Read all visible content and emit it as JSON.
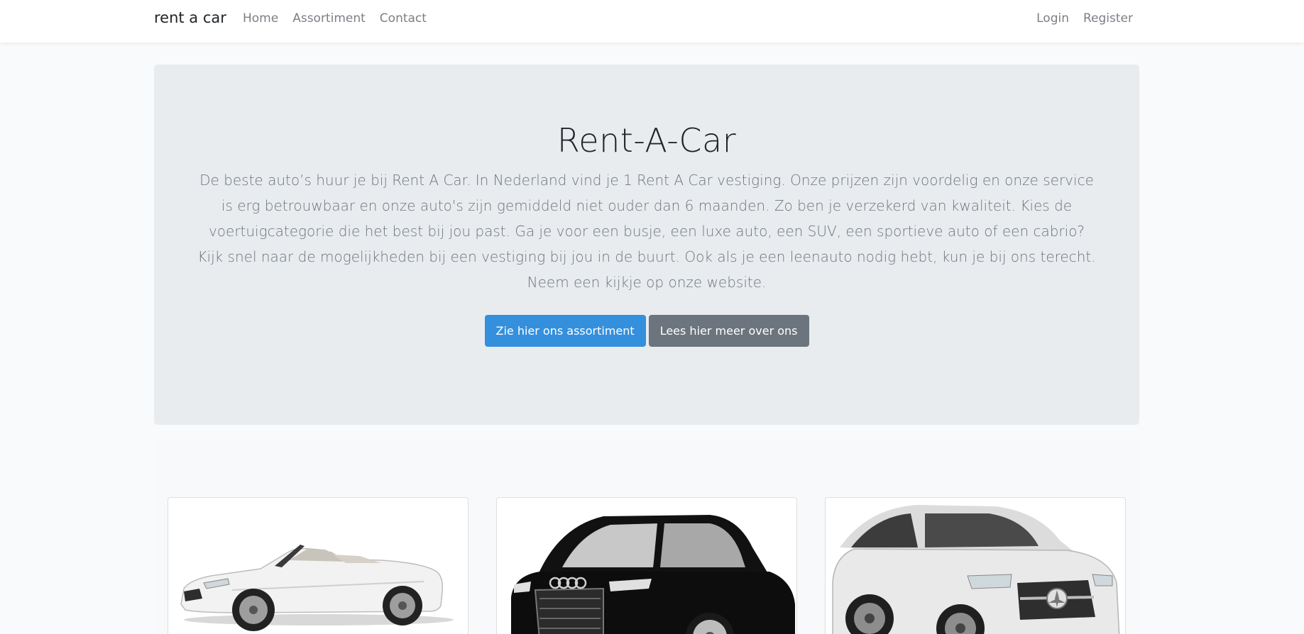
{
  "navbar": {
    "brand": "rent a car",
    "left_links": [
      "Home",
      "Assortiment",
      "Contact"
    ],
    "right_links": [
      "Login",
      "Register"
    ]
  },
  "jumbotron": {
    "title": "Rent-A-Car",
    "text": "De beste auto’s huur je bij Rent A Car. In Nederland vind je 1 Rent A Car vestiging. Onze prijzen zijn voordelig en onze service is erg betrouwbaar en onze auto's zijn gemiddeld niet ouder dan 6 maanden. Zo ben je verzekerd van kwaliteit. Kies de voertuigcategorie die het best bij jou past. Ga je voor een busje, een luxe auto, een SUV, een sportieve auto of een cabrio? Kijk snel naar de mogelijkheden bij een vestiging bij jou in de buurt. Ook als je een leenauto nodig hebt, kun je bij ons terecht. Neem een kijkje op onze website.",
    "primary_button": "Zie hier ons assortiment",
    "secondary_button": "Lees hier meer over ons"
  },
  "cards": [
    {
      "image": "white-convertible-car-image"
    },
    {
      "image": "black-sedan-car-image"
    },
    {
      "image": "white-suv-coupe-car-image"
    }
  ],
  "colors": {
    "primary": "#3490dc",
    "secondary": "#6c757d",
    "jumbotron_bg": "#e9ecef",
    "page_bg": "#f8fafc"
  }
}
